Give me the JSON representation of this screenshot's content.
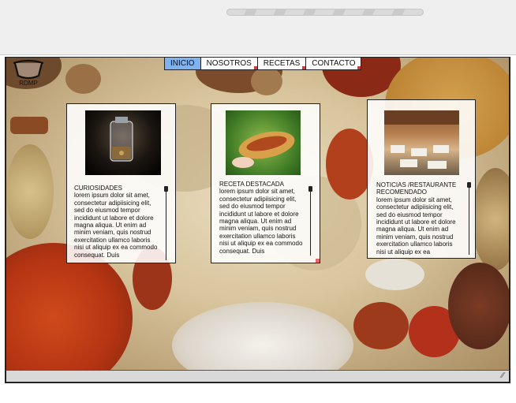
{
  "browser": {
    "address_bar": ""
  },
  "logo": {
    "label": "RDMP",
    "icon": "pot-icon"
  },
  "nav": {
    "items": [
      {
        "label": "INICIO",
        "active": true
      },
      {
        "label": "NOSOTROS",
        "active": false
      },
      {
        "label": "RECETAS",
        "active": false
      },
      {
        "label": "CONTACTO",
        "active": false
      }
    ]
  },
  "cards": [
    {
      "title": "CURIOSIDADES",
      "text": "lorem ipsum dolor sit amet, consectetur adipiisicing elit, sed do eiusmod tempor incididunt ut labore et dolore magna aliqua. Ut enim ad minim veniam, quis nostrud exercitation ullamco laboris nisi ut aliquip ex ea commodo consequat. Duis",
      "image": "spice-jar-photo"
    },
    {
      "title": "RECETA DESTACADA",
      "text": "lorem ipsum dolor sit amet, consectetur adipiisicing elit, sed do eiusmod tempor incididunt ut labore et dolore magna aliqua. Ut enim ad minim veniam, quis nostrud exercitation ullamco laboris nisi ut aliquip ex ea commodo consequat. Duis",
      "image": "stuffed-bread-photo"
    },
    {
      "title": "NOTICIAS /RESTAURANTE RECOMENDADO",
      "text": "lorem ipsum dolor sit amet, consectetur adipiisicing elit, sed do eiusmod tempor incididunt ut labore et dolore magna aliqua. Ut enim ad minim veniam, quis nostrud exercitation ullamco laboris nisi ut aliquip ex ea",
      "image": "restaurant-terrace-photo"
    }
  ],
  "colors": {
    "nav_active": "#7fb2f0",
    "accent_red": "#d23a3a"
  }
}
